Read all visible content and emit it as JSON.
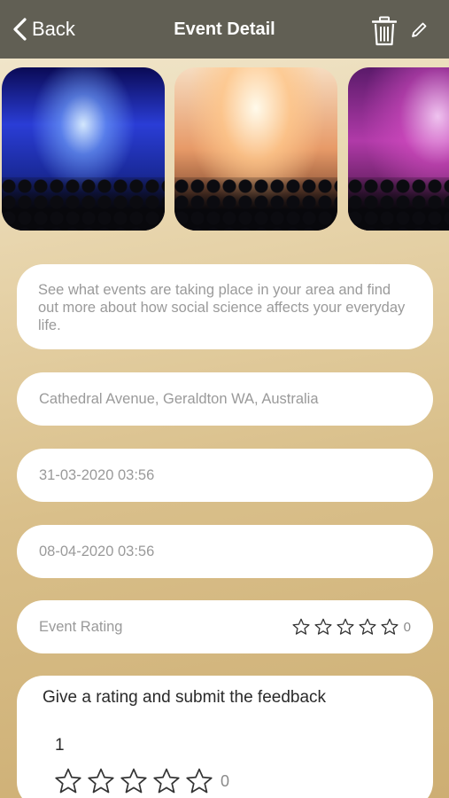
{
  "header": {
    "back_label": "Back",
    "title": "Event Detail",
    "delete_icon": "trash-icon",
    "edit_icon": "pencil-icon",
    "bg_color": "#615f54"
  },
  "event": {
    "description": "See what events are taking place in your area and find out more about how social science affects your everyday life.",
    "location": "Cathedral Avenue, Geraldton WA, Australia",
    "start_datetime": "31-03-2020 03:56",
    "end_datetime": "08-04-2020 03:56",
    "rating_label": "Event Rating",
    "rating_count": "0",
    "rating_stars": 0
  },
  "feedback": {
    "title": "Give a rating and submit the feedback",
    "number": "1",
    "rating_count": "0",
    "rating_stars": 0
  }
}
